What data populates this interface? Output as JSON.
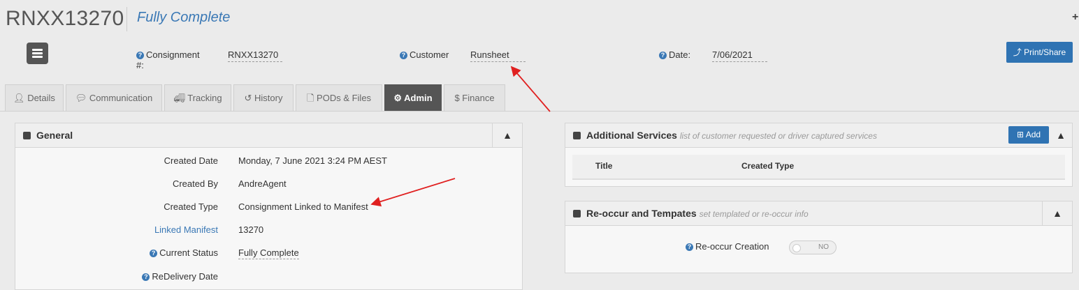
{
  "header": {
    "consignment_id": "RNXX13270",
    "status": "Fully Complete",
    "plus_icon": "+"
  },
  "meta": {
    "consignment_label": "Consignment #:",
    "consignment_value": "RNXX13270",
    "customer_label": "Customer",
    "customer_value": "Runsheet",
    "date_label": "Date:",
    "date_value": "7/06/2021",
    "print_label": "Print/Share"
  },
  "tabs": [
    {
      "label": "Details",
      "icon": "user-icon"
    },
    {
      "label": "Communication",
      "icon": "comment-icon"
    },
    {
      "label": "Tracking",
      "icon": "truck-icon"
    },
    {
      "label": "History",
      "icon": "history-icon"
    },
    {
      "label": "PODs & Files",
      "icon": "file-icon"
    },
    {
      "label": "Admin",
      "icon": "gear-icon",
      "active": true
    },
    {
      "label": "Finance",
      "icon": "dollar-icon"
    }
  ],
  "general": {
    "title": "General",
    "rows": [
      {
        "label": "Created Date",
        "value": "Monday, 7 June 2021 3:24 PM AEST"
      },
      {
        "label": "Created By",
        "value": "AndreAgent"
      },
      {
        "label": "Created Type",
        "value": "Consignment Linked to Manifest"
      },
      {
        "label": "Linked Manifest",
        "value": "13270"
      },
      {
        "label": "Current Status",
        "value": "Fully Complete"
      },
      {
        "label": "ReDelivery Date",
        "value": ""
      }
    ]
  },
  "additional_services": {
    "title": "Additional Services",
    "subtitle": "list of customer requested or driver captured services",
    "add_label": "Add",
    "columns": [
      "Title",
      "Created Type"
    ]
  },
  "reoccur": {
    "title": "Re-occur and Tempates",
    "subtitle": "set templated or re-occur info",
    "creation_label": "Re-occur Creation",
    "toggle_value": "NO"
  },
  "colors": {
    "accent": "#2f73b3",
    "link": "#3a78b5",
    "active_tab": "#555555",
    "annotation": "#e02020"
  }
}
